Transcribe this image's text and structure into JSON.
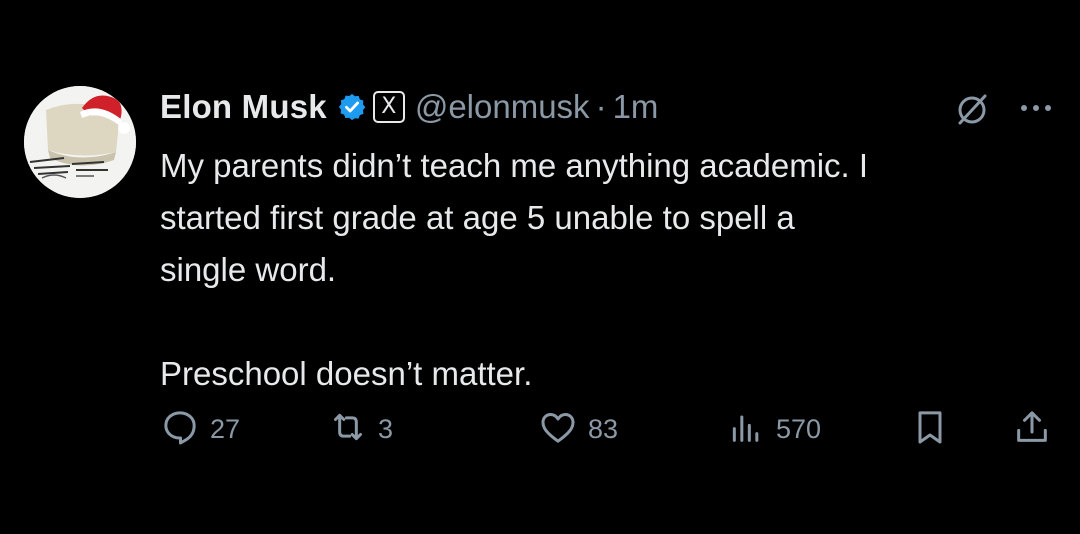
{
  "tweet": {
    "author_name": "Elon Musk",
    "handle": "@elonmusk",
    "separator": "·",
    "time": "1m",
    "affiliation_badge": "X",
    "body_lines": [
      "My parents didn’t teach me anything academic. I",
      "started first grade at age 5 unable to spell a",
      "single word.",
      "Preschool doesn’t matter."
    ],
    "metrics": {
      "replies": "27",
      "reposts": "3",
      "likes": "83",
      "views": "570"
    }
  },
  "colors": {
    "background": "#000000",
    "text_primary": "#e7e9ea",
    "text_secondary": "#8b98a5",
    "verified_blue": "#1d9bf0"
  },
  "icons": [
    "avatar",
    "verified-badge-icon",
    "x-affiliation-icon",
    "grok-icon",
    "more-icon",
    "reply-icon",
    "repost-icon",
    "like-icon",
    "views-icon",
    "bookmark-icon",
    "share-icon"
  ]
}
